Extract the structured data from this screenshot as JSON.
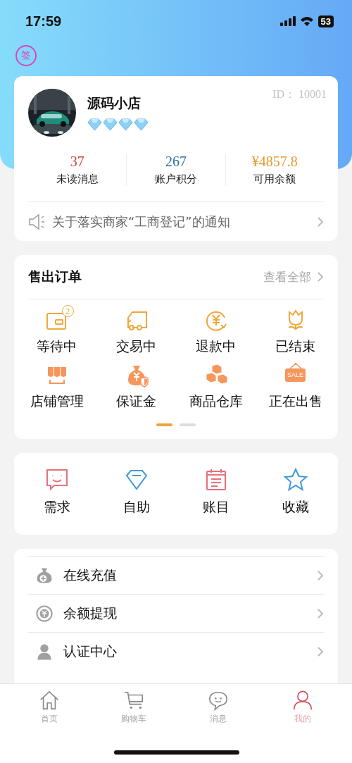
{
  "status_bar": {
    "time": "17:59",
    "battery": "53"
  },
  "sign_in": {
    "label": "签"
  },
  "profile": {
    "name": "源码小店",
    "stars": 4,
    "id": "ID： 10001",
    "stats": [
      {
        "value": "37",
        "label": "未读消息",
        "color": "#c8443c"
      },
      {
        "value": "267",
        "label": "账户积分",
        "color": "#2f6f9f"
      },
      {
        "value": "¥4857.8",
        "label": "可用余额",
        "color": "#e39a2d"
      }
    ],
    "notice": "关于落实商家“工商登记”的通知"
  },
  "orders": {
    "title": "售出订单",
    "link": "查看全部",
    "items": [
      {
        "label": "等待中",
        "badge": "2"
      },
      {
        "label": "交易中"
      },
      {
        "label": "退款中"
      },
      {
        "label": "已结束"
      },
      {
        "label": "店铺管理"
      },
      {
        "label": "保证金"
      },
      {
        "label": "商品仓库"
      },
      {
        "label": "正在出售",
        "sign": "SALE"
      }
    ],
    "pages": [
      {
        "selected": true
      },
      {
        "selected": false
      }
    ]
  },
  "services": [
    {
      "label": "需求"
    },
    {
      "label": "自助"
    },
    {
      "label": "账目"
    },
    {
      "label": "收藏"
    }
  ],
  "menu": [
    {
      "label": "在线充值"
    },
    {
      "label": "余额提现"
    },
    {
      "label": "认证中心"
    }
  ],
  "tabs": [
    {
      "label": "首页",
      "selected": false
    },
    {
      "label": "购物车",
      "selected": false
    },
    {
      "label": "消息",
      "selected": false
    },
    {
      "label": "我的",
      "selected": true
    }
  ]
}
